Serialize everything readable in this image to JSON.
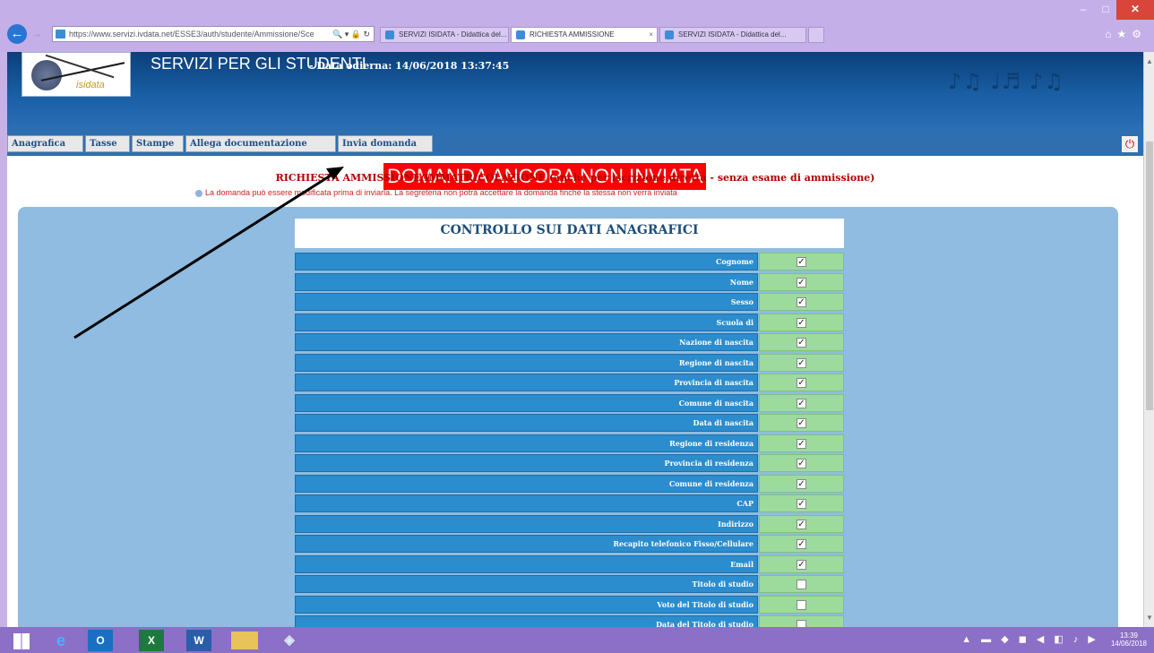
{
  "browser": {
    "address": "https://www.servizi.ivdata.net/ESSE3/auth/studente/Ammissione/Sce",
    "address_tools": "🔍 ▾ 🔒 ↻",
    "tabs": [
      {
        "label": "SERVIZI ISIDATA - Didattica del..."
      },
      {
        "label": "RICHIESTA AMMISSIONE"
      },
      {
        "label": "SERVIZI ISIDATA - Didattica del..."
      }
    ],
    "tab_close": "×"
  },
  "header": {
    "logo_text": "isidata",
    "title": "SERVIZI PER GLI STUDENTI",
    "date_text": "- Data odierna: 14/06/2018 13:37:45",
    "deco_text": "♪♫ ♩♬ ♪♫"
  },
  "menu": {
    "items": [
      {
        "label": "Anagrafica"
      },
      {
        "label": "Tasse"
      },
      {
        "label": "Stampe"
      },
      {
        "label": "Allega documentazione"
      },
      {
        "label": "Invia domanda"
      }
    ]
  },
  "main": {
    "status_banner": "DOMANDA ANCORA NON INVIATA",
    "request_title": "RICHIESTA AMMISSIONE/IMMATRICOLAZIONE (anche per iscrizione diretta - senza esame di ammissione)",
    "request_note": "La domanda può essere modificata prima di inviarla. La segreteria non potrà accettare la domanda finché la stessa non verrà inviata",
    "check_title": "CONTROLLO SUI DATI ANAGRAFICI",
    "check_rows": [
      {
        "label": "Cognome",
        "checked": true
      },
      {
        "label": "Nome",
        "checked": true
      },
      {
        "label": "Sesso",
        "checked": true
      },
      {
        "label": "Scuola di",
        "checked": true
      },
      {
        "label": "Nazione di nascita",
        "checked": true
      },
      {
        "label": "Regione di nascita",
        "checked": true
      },
      {
        "label": "Provincia di nascita",
        "checked": true
      },
      {
        "label": "Comune di nascita",
        "checked": true
      },
      {
        "label": "Data di nascita",
        "checked": true
      },
      {
        "label": "Regione di residenza",
        "checked": true
      },
      {
        "label": "Provincia di residenza",
        "checked": true
      },
      {
        "label": "Comune di residenza",
        "checked": true
      },
      {
        "label": "CAP",
        "checked": true
      },
      {
        "label": "Indirizzo",
        "checked": true
      },
      {
        "label": "Recapito telefonico Fisso/Cellulare",
        "checked": true
      },
      {
        "label": "Email",
        "checked": true
      },
      {
        "label": "Titolo di studio",
        "checked": false
      },
      {
        "label": "Voto del Titolo di studio",
        "checked": false
      },
      {
        "label": "Data del Titolo di studio",
        "checked": false
      }
    ]
  },
  "taskbar": {
    "tray_icons": "▲ ▬ ◆ ◼ ◀ ◧ ♪ ▶",
    "clock_time": "13:39",
    "clock_date": "14/06/2018"
  },
  "colors": {
    "status_banner_bg": "#ff0000",
    "header_bg": "#1a5fa5",
    "panel_bg": "#8fbce0",
    "row_label_bg": "#2b8cce",
    "row_check_bg": "#9cdb9c",
    "taskbar_bg": "#8c6fc6"
  }
}
